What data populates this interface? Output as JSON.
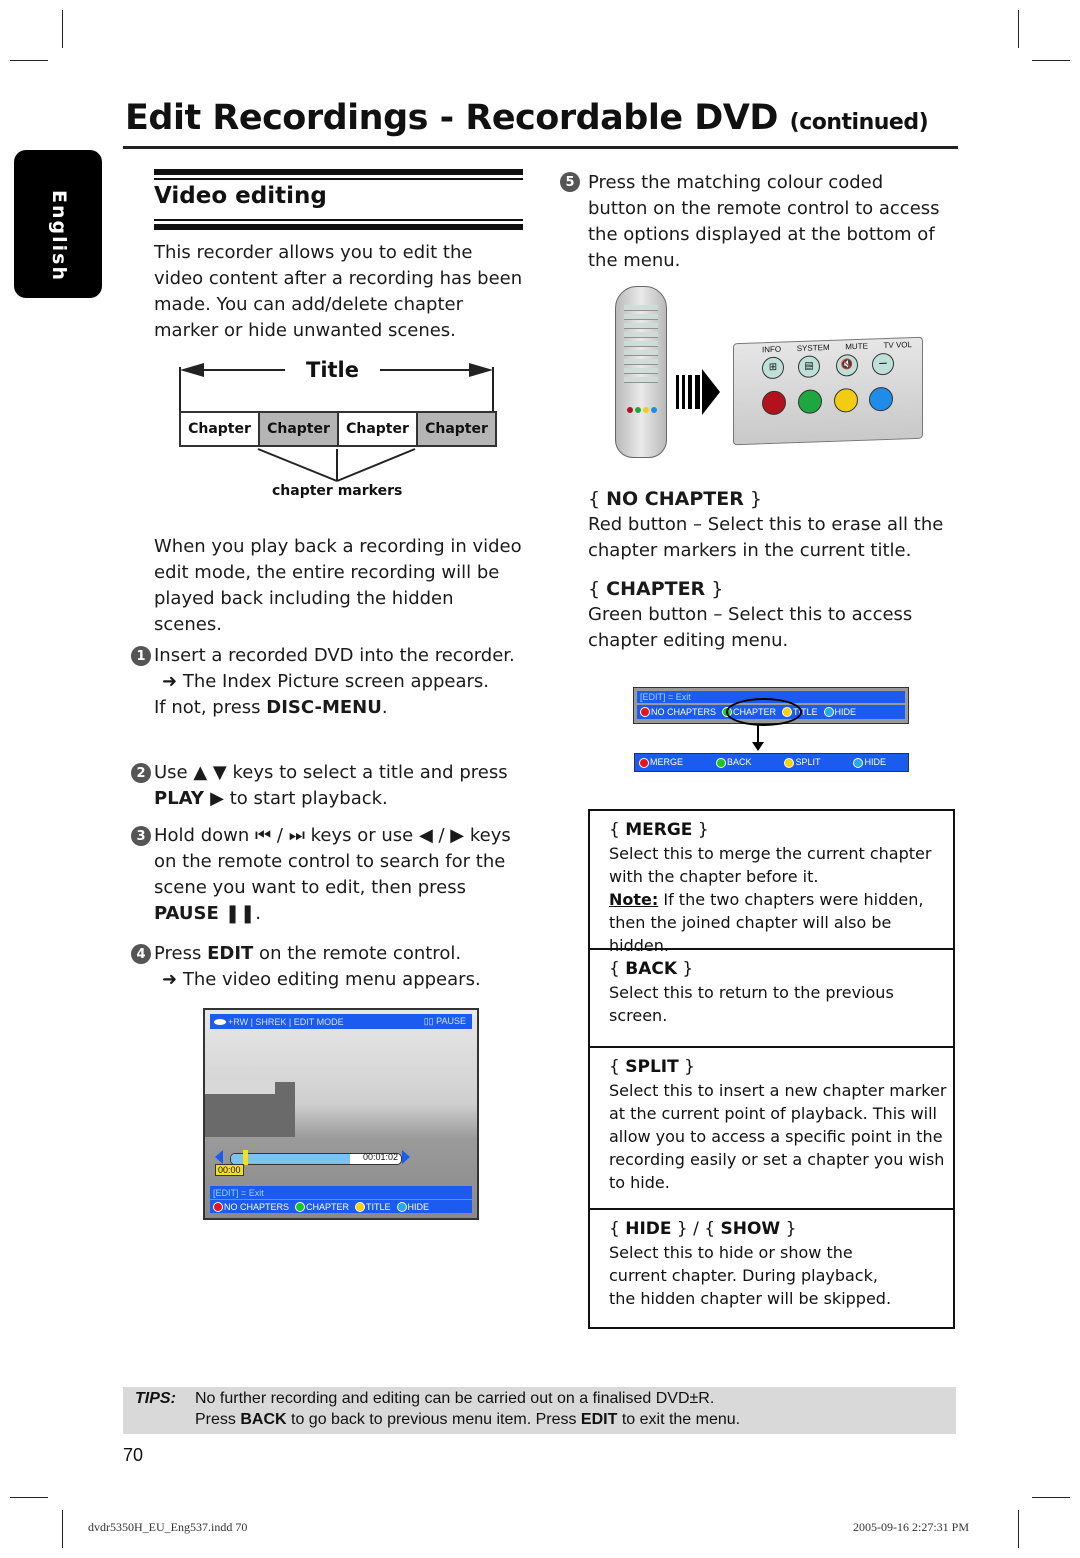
{
  "header": {
    "title": "Edit Recordings - Recordable DVD",
    "title_suffix": "(continued)"
  },
  "language_tab": "English",
  "section": {
    "heading": "Video editing",
    "intro": "This recorder allows you to edit the video content after a recording has been made. You can add/delete chapter marker or hide unwanted scenes."
  },
  "diagram": {
    "title_label": "Title",
    "chapters": [
      "Chapter",
      "Chapter",
      "Chapter",
      "Chapter"
    ],
    "markers_label": "chapter markers"
  },
  "playback_note": "When you play back a recording in video edit mode, the entire recording will be played back including the hidden scenes.",
  "steps": [
    {
      "num": "1",
      "lines": [
        "Insert a recorded DVD into the recorder."
      ],
      "result": "The Index Picture screen appears.",
      "extra_pre": "If not, press ",
      "extra_bold": "DISC-MENU",
      "extra_post": "."
    },
    {
      "num": "2",
      "pre": "Use ▲ ▼ keys to select a title and press ",
      "bold": "PLAY ▶",
      "post": " to start playback."
    },
    {
      "num": "3",
      "pre": "Hold down ⏮ / ⏭  keys or use ◀ / ▶ keys on the remote control to search for the scene you want to edit, then press ",
      "bold": "PAUSE ❚❚",
      "post": "."
    },
    {
      "num": "4",
      "pre": "Press ",
      "bold": "EDIT",
      "post": " on the remote control.",
      "result": "The video editing menu appears."
    },
    {
      "num": "5",
      "text": "Press the matching colour coded button on the remote control to access the options displayed at the bottom of the menu."
    }
  ],
  "tv_screen": {
    "top_bar": "+RW | SHREK | EDIT MODE",
    "status": "PAUSE",
    "time_total": "00:01:02",
    "time_current": "00:00",
    "progress": 0.7,
    "exit_hint": "[EDIT] = Exit",
    "options": [
      {
        "label": "NO CHAPTERS",
        "color": "#e8141c"
      },
      {
        "label": "CHAPTER",
        "color": "#19c81e"
      },
      {
        "label": "TITLE",
        "color": "#f4d20e"
      },
      {
        "label": "HIDE",
        "color": "#2aa6f0"
      }
    ]
  },
  "remote": {
    "labels": [
      "INFO",
      "SYSTEM",
      "MUTE",
      "TV VOL"
    ],
    "buttons": [
      {
        "name": "red",
        "color": "#b3121c"
      },
      {
        "name": "green",
        "color": "#1ea640"
      },
      {
        "name": "yellow",
        "color": "#f2cc10"
      },
      {
        "name": "blue",
        "color": "#1e8ce8"
      }
    ]
  },
  "options_desc": [
    {
      "name": "NO CHAPTER",
      "text": "Red button – Select this to erase all the chapter markers in the current title."
    },
    {
      "name": "CHAPTER",
      "text": "Green button – Select this to access chapter editing menu."
    }
  ],
  "chapter_menu": {
    "exit_hint": "[EDIT] = Exit",
    "top_options": [
      {
        "label": "NO CHAPTERS",
        "color": "#e8141c"
      },
      {
        "label": "CHAPTER",
        "color": "#19c81e"
      },
      {
        "label": "TITLE",
        "color": "#f4d20e"
      },
      {
        "label": "HIDE",
        "color": "#2aa6f0"
      }
    ],
    "sub_options": [
      {
        "label": "MERGE",
        "color": "#e8141c"
      },
      {
        "label": "BACK",
        "color": "#19c81e"
      },
      {
        "label": "SPLIT",
        "color": "#f4d20e"
      },
      {
        "label": "HIDE",
        "color": "#2aa6f0"
      }
    ]
  },
  "option_boxes": [
    {
      "name": "MERGE",
      "text": "Select this to merge the current chapter with the chapter before it.",
      "note_label": "Note:",
      "note": " If the two chapters were hidden, then the joined chapter will also be hidden."
    },
    {
      "name": "BACK",
      "text": "Select this to return to the previous screen."
    },
    {
      "name": "SPLIT",
      "text": "Select this to insert a new chapter marker at the current point of playback. This will allow you to access a specific point in the recording easily or set a chapter you wish to hide."
    },
    {
      "name": "HIDE",
      "name2": "SHOW",
      "text": "Select this to hide or show the current chapter. During playback, the hidden chapter will be skipped."
    }
  ],
  "tips": {
    "label": "TIPS:",
    "line1": "No further recording and editing can be carried out on a finalised DVD±R.",
    "line2_pre": "Press ",
    "line2_b1": "BACK",
    "line2_mid": " to go back to previous menu item. Press ",
    "line2_b2": "EDIT",
    "line2_post": " to exit the menu."
  },
  "page_number": "70",
  "footer": {
    "file": "dvdr5350H_EU_Eng537.indd   70",
    "timestamp": "2005-09-16   2:27:31 PM"
  }
}
